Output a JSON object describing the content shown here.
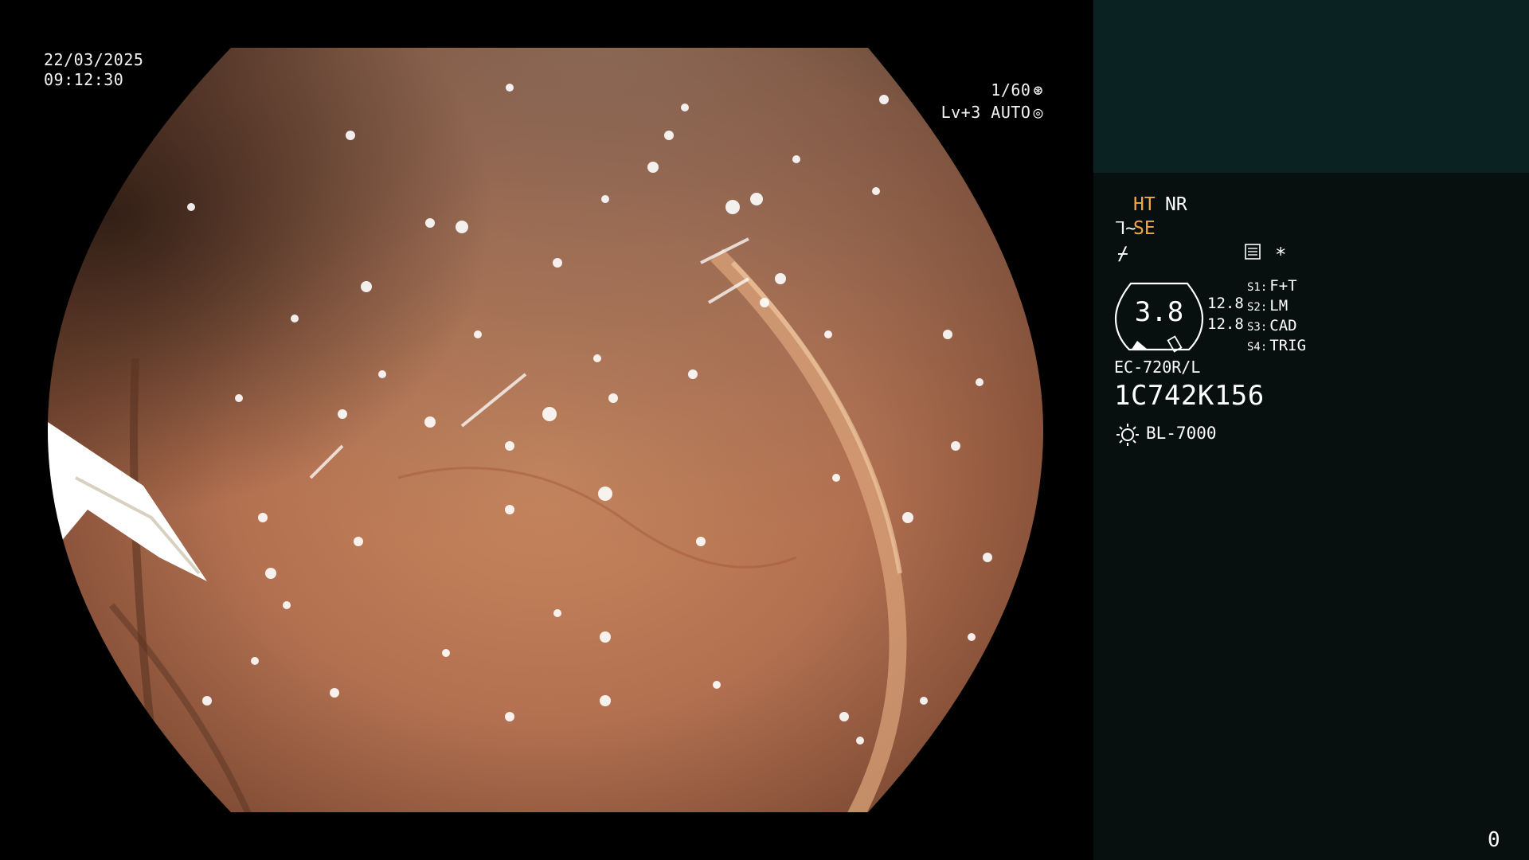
{
  "osd": {
    "date": "22/03/2025",
    "time": "09:12:30",
    "shutter": "1/60",
    "shutter_icon": "aperture-icon",
    "level": "Lv+3 AUTO",
    "level_icon": "iris-icon"
  },
  "panel": {
    "ht": "HT",
    "nr": "NR",
    "se_icon": "⅂~",
    "se": "SE",
    "f_icon": "⌿",
    "menu_icon": "menu-icon",
    "star": "*",
    "gauge_value": "3.8",
    "num1": "12.8",
    "num2": "12.8",
    "switches": [
      {
        "key": "S1:",
        "value": "F+T"
      },
      {
        "key": "S2:",
        "value": "LM"
      },
      {
        "key": "S3:",
        "value": "CAD"
      },
      {
        "key": "S4:",
        "value": "TRIG"
      }
    ],
    "model": "EC-720R/L",
    "serial": "1C742K156",
    "lamp_icon": "sun-icon",
    "lamp": "BL-7000",
    "counter": "0"
  },
  "colors": {
    "accent_orange": "#f5a64a",
    "panel_bg": "#07100f",
    "panel_top_bg": "#0b2222"
  }
}
